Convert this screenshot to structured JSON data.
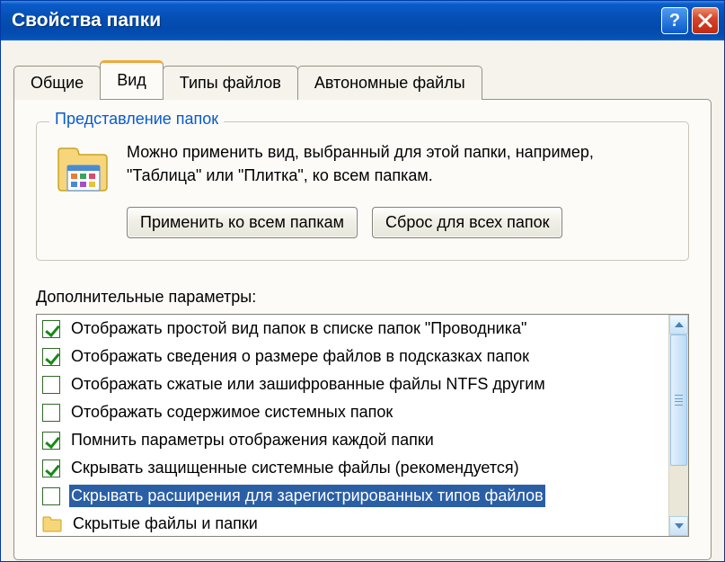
{
  "window": {
    "title": "Свойства папки"
  },
  "tabs": {
    "items": [
      {
        "label": "Общие",
        "active": false
      },
      {
        "label": "Вид",
        "active": true
      },
      {
        "label": "Типы файлов",
        "active": false
      },
      {
        "label": "Автономные файлы",
        "active": false
      }
    ]
  },
  "viewTab": {
    "groupTitle": "Представление папок",
    "description": "Можно применить вид, выбранный для этой папки, например, \"Таблица\" или \"Плитка\", ко всем папкам.",
    "applyButton": "Применить ко всем папкам",
    "resetButton": "Сброс для всех папок",
    "advancedLabel": "Дополнительные параметры:",
    "options": [
      {
        "type": "checkbox",
        "checked": true,
        "selected": false,
        "label": "Отображать простой вид папок в списке папок \"Проводника\""
      },
      {
        "type": "checkbox",
        "checked": true,
        "selected": false,
        "label": "Отображать сведения о размере файлов в подсказках папок"
      },
      {
        "type": "checkbox",
        "checked": false,
        "selected": false,
        "label": "Отображать сжатые или зашифрованные файлы NTFS другим"
      },
      {
        "type": "checkbox",
        "checked": false,
        "selected": false,
        "label": "Отображать содержимое системных папок"
      },
      {
        "type": "checkbox",
        "checked": true,
        "selected": false,
        "label": "Помнить параметры отображения каждой папки"
      },
      {
        "type": "checkbox",
        "checked": true,
        "selected": false,
        "label": "Скрывать защищенные системные файлы (рекомендуется)"
      },
      {
        "type": "checkbox",
        "checked": false,
        "selected": true,
        "label": "Скрывать расширения для зарегистрированных типов файлов"
      },
      {
        "type": "folder",
        "checked": false,
        "selected": false,
        "label": "Скрытые файлы и папки"
      }
    ]
  }
}
